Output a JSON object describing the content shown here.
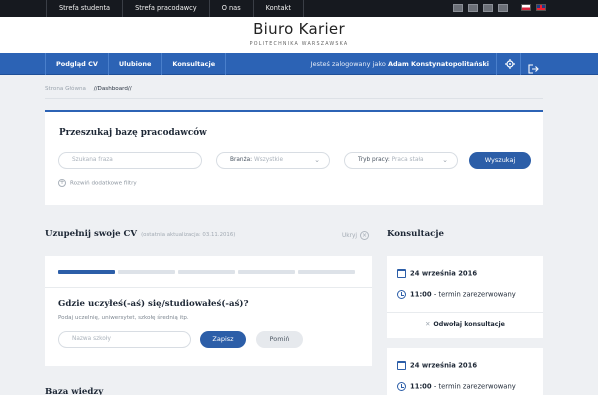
{
  "topbar": {
    "nav": [
      "Strefa studenta",
      "Strefa pracodawcy",
      "O nas",
      "Kontakt"
    ],
    "languages": [
      "pl",
      "en"
    ]
  },
  "brand": {
    "logo": "Biuro Karier",
    "subtitle": "POLITECHNIKA WARSZAWSKA"
  },
  "mainnav": {
    "items": [
      "Podgląd CV",
      "Ulubione",
      "Konsultacje"
    ],
    "user_prefix": "Jesteś zalogowany jako",
    "user_name": "Adam Konstynatopolitański"
  },
  "breadcrumb": {
    "home": "Strona Główna",
    "current": "//Dashboard//"
  },
  "search": {
    "title": "Przeszukaj bazę pracodawców",
    "query_placeholder": "Szukana fraza",
    "industry_label": "Branża:",
    "industry_value": "Wszystkie",
    "worktype_label": "Tryb pracy:",
    "worktype_value": "Praca stała",
    "submit": "Wyszukaj",
    "more_filters": "Rozwiń dodatkowe filtry"
  },
  "cv": {
    "title": "Uzupełnij swoje CV",
    "last_update": "(ostatnia aktualizacja: 03.11.2016)",
    "hide": "Ukryj",
    "progress": {
      "completed_steps": 1,
      "total_steps": 5
    },
    "question": "Gdzie uczyłeś(-aś) się/studiowałeś(-aś)?",
    "hint": "Podaj uczelnię, uniwersytet, szkołę średnią itp.",
    "input_placeholder": "Nazwa szkoły",
    "save": "Zapisz",
    "skip": "Pomiń"
  },
  "consultations": {
    "title": "Konsultacje",
    "items": [
      {
        "date": "24 września 2016",
        "time": "11:00",
        "status": "- termin zarezerwowany",
        "cancel": "Odwołaj konsultacje"
      },
      {
        "date": "24 września 2016",
        "time": "11:00",
        "status": "- termin zarezerwowany"
      }
    ]
  },
  "knowledge": {
    "title": "Baza wiedzy"
  }
}
